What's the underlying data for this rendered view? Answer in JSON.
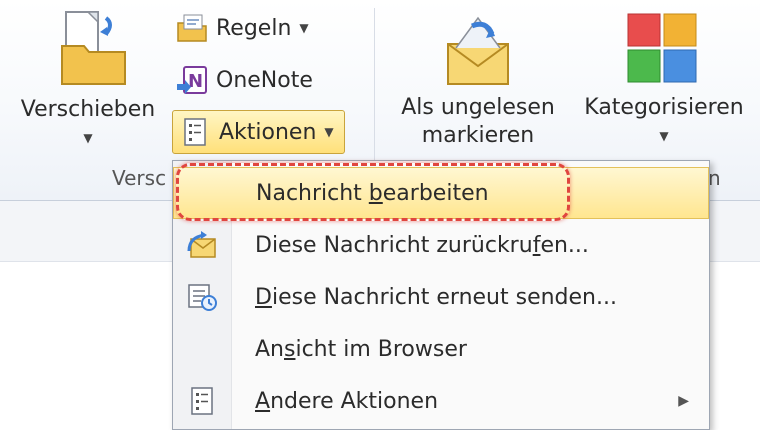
{
  "ribbon": {
    "move": {
      "label": "Verschieben",
      "group_label": "Versc"
    },
    "rules": {
      "label": "Regeln"
    },
    "onenote": {
      "label": "OneNote"
    },
    "actions": {
      "label": "Aktionen"
    },
    "mark_unread": {
      "line1": "Als ungelesen",
      "line2": "markieren"
    },
    "categorize": {
      "label": "Kategorisieren"
    },
    "group_tail": "n"
  },
  "menu": {
    "items": [
      {
        "pre": "Nachricht ",
        "u": "b",
        "post": "earbeiten",
        "icon": "none",
        "highlighted": true
      },
      {
        "pre": "Diese Nachricht zurückru",
        "u": "f",
        "post": "en...",
        "icon": "recall-icon"
      },
      {
        "pre": "",
        "u": "D",
        "post": "iese Nachricht erneut senden...",
        "icon": "resend-icon"
      },
      {
        "pre": "An",
        "u": "s",
        "post": "icht im Browser",
        "icon": "none"
      },
      {
        "pre": "",
        "u": "A",
        "post": "ndere Aktionen",
        "icon": "actions-icon",
        "submenu": true
      }
    ]
  },
  "colors": {
    "highlight": "#ffe690",
    "annotation_ring": "#e0463f"
  }
}
